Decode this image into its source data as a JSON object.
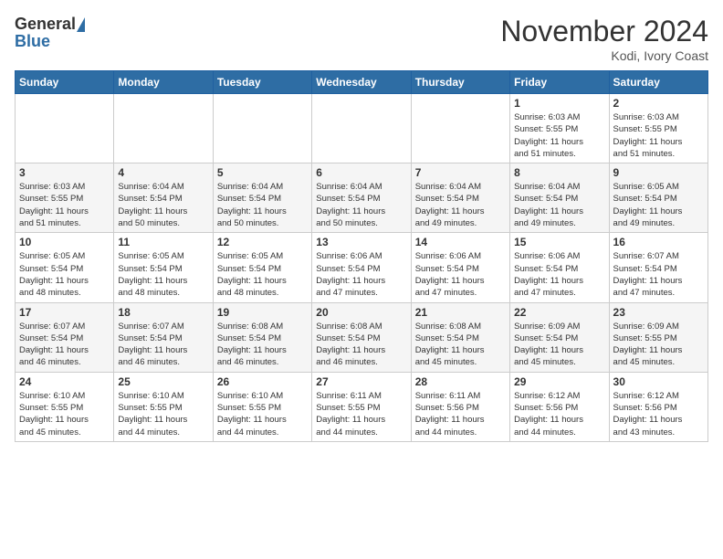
{
  "header": {
    "logo_general": "General",
    "logo_blue": "Blue",
    "month_title": "November 2024",
    "location": "Kodi, Ivory Coast"
  },
  "days_of_week": [
    "Sunday",
    "Monday",
    "Tuesday",
    "Wednesday",
    "Thursday",
    "Friday",
    "Saturday"
  ],
  "weeks": [
    [
      {
        "date": "",
        "info": ""
      },
      {
        "date": "",
        "info": ""
      },
      {
        "date": "",
        "info": ""
      },
      {
        "date": "",
        "info": ""
      },
      {
        "date": "",
        "info": ""
      },
      {
        "date": "1",
        "info": "Sunrise: 6:03 AM\nSunset: 5:55 PM\nDaylight: 11 hours\nand 51 minutes."
      },
      {
        "date": "2",
        "info": "Sunrise: 6:03 AM\nSunset: 5:55 PM\nDaylight: 11 hours\nand 51 minutes."
      }
    ],
    [
      {
        "date": "3",
        "info": "Sunrise: 6:03 AM\nSunset: 5:55 PM\nDaylight: 11 hours\nand 51 minutes."
      },
      {
        "date": "4",
        "info": "Sunrise: 6:04 AM\nSunset: 5:54 PM\nDaylight: 11 hours\nand 50 minutes."
      },
      {
        "date": "5",
        "info": "Sunrise: 6:04 AM\nSunset: 5:54 PM\nDaylight: 11 hours\nand 50 minutes."
      },
      {
        "date": "6",
        "info": "Sunrise: 6:04 AM\nSunset: 5:54 PM\nDaylight: 11 hours\nand 50 minutes."
      },
      {
        "date": "7",
        "info": "Sunrise: 6:04 AM\nSunset: 5:54 PM\nDaylight: 11 hours\nand 49 minutes."
      },
      {
        "date": "8",
        "info": "Sunrise: 6:04 AM\nSunset: 5:54 PM\nDaylight: 11 hours\nand 49 minutes."
      },
      {
        "date": "9",
        "info": "Sunrise: 6:05 AM\nSunset: 5:54 PM\nDaylight: 11 hours\nand 49 minutes."
      }
    ],
    [
      {
        "date": "10",
        "info": "Sunrise: 6:05 AM\nSunset: 5:54 PM\nDaylight: 11 hours\nand 48 minutes."
      },
      {
        "date": "11",
        "info": "Sunrise: 6:05 AM\nSunset: 5:54 PM\nDaylight: 11 hours\nand 48 minutes."
      },
      {
        "date": "12",
        "info": "Sunrise: 6:05 AM\nSunset: 5:54 PM\nDaylight: 11 hours\nand 48 minutes."
      },
      {
        "date": "13",
        "info": "Sunrise: 6:06 AM\nSunset: 5:54 PM\nDaylight: 11 hours\nand 47 minutes."
      },
      {
        "date": "14",
        "info": "Sunrise: 6:06 AM\nSunset: 5:54 PM\nDaylight: 11 hours\nand 47 minutes."
      },
      {
        "date": "15",
        "info": "Sunrise: 6:06 AM\nSunset: 5:54 PM\nDaylight: 11 hours\nand 47 minutes."
      },
      {
        "date": "16",
        "info": "Sunrise: 6:07 AM\nSunset: 5:54 PM\nDaylight: 11 hours\nand 47 minutes."
      }
    ],
    [
      {
        "date": "17",
        "info": "Sunrise: 6:07 AM\nSunset: 5:54 PM\nDaylight: 11 hours\nand 46 minutes."
      },
      {
        "date": "18",
        "info": "Sunrise: 6:07 AM\nSunset: 5:54 PM\nDaylight: 11 hours\nand 46 minutes."
      },
      {
        "date": "19",
        "info": "Sunrise: 6:08 AM\nSunset: 5:54 PM\nDaylight: 11 hours\nand 46 minutes."
      },
      {
        "date": "20",
        "info": "Sunrise: 6:08 AM\nSunset: 5:54 PM\nDaylight: 11 hours\nand 46 minutes."
      },
      {
        "date": "21",
        "info": "Sunrise: 6:08 AM\nSunset: 5:54 PM\nDaylight: 11 hours\nand 45 minutes."
      },
      {
        "date": "22",
        "info": "Sunrise: 6:09 AM\nSunset: 5:54 PM\nDaylight: 11 hours\nand 45 minutes."
      },
      {
        "date": "23",
        "info": "Sunrise: 6:09 AM\nSunset: 5:55 PM\nDaylight: 11 hours\nand 45 minutes."
      }
    ],
    [
      {
        "date": "24",
        "info": "Sunrise: 6:10 AM\nSunset: 5:55 PM\nDaylight: 11 hours\nand 45 minutes."
      },
      {
        "date": "25",
        "info": "Sunrise: 6:10 AM\nSunset: 5:55 PM\nDaylight: 11 hours\nand 44 minutes."
      },
      {
        "date": "26",
        "info": "Sunrise: 6:10 AM\nSunset: 5:55 PM\nDaylight: 11 hours\nand 44 minutes."
      },
      {
        "date": "27",
        "info": "Sunrise: 6:11 AM\nSunset: 5:55 PM\nDaylight: 11 hours\nand 44 minutes."
      },
      {
        "date": "28",
        "info": "Sunrise: 6:11 AM\nSunset: 5:56 PM\nDaylight: 11 hours\nand 44 minutes."
      },
      {
        "date": "29",
        "info": "Sunrise: 6:12 AM\nSunset: 5:56 PM\nDaylight: 11 hours\nand 44 minutes."
      },
      {
        "date": "30",
        "info": "Sunrise: 6:12 AM\nSunset: 5:56 PM\nDaylight: 11 hours\nand 43 minutes."
      }
    ]
  ]
}
